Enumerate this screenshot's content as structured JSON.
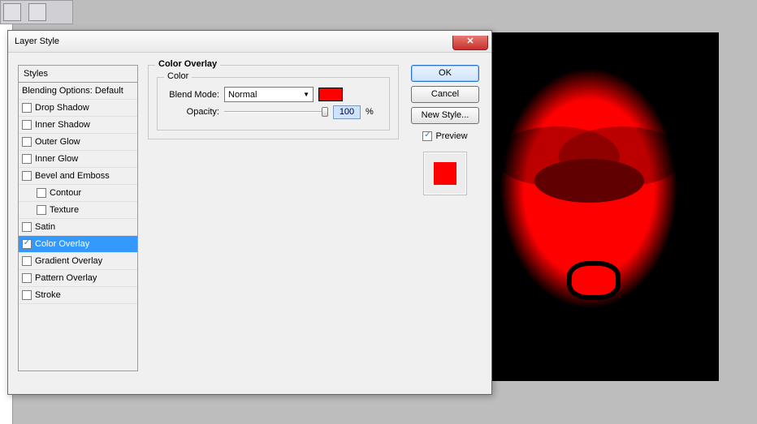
{
  "dialog": {
    "title": "Layer Style",
    "styles_header": "Styles",
    "styles": [
      {
        "label": "Blending Options: Default",
        "checked": null
      },
      {
        "label": "Drop Shadow",
        "checked": false
      },
      {
        "label": "Inner Shadow",
        "checked": false
      },
      {
        "label": "Outer Glow",
        "checked": false
      },
      {
        "label": "Inner Glow",
        "checked": false
      },
      {
        "label": "Bevel and Emboss",
        "checked": false
      },
      {
        "label": "Contour",
        "checked": false,
        "indent": true
      },
      {
        "label": "Texture",
        "checked": false,
        "indent": true
      },
      {
        "label": "Satin",
        "checked": false
      },
      {
        "label": "Color Overlay",
        "checked": true,
        "selected": true
      },
      {
        "label": "Gradient Overlay",
        "checked": false
      },
      {
        "label": "Pattern Overlay",
        "checked": false
      },
      {
        "label": "Stroke",
        "checked": false
      }
    ],
    "section_title": "Color Overlay",
    "color_group": "Color",
    "blend_mode_label": "Blend Mode:",
    "blend_mode_value": "Normal",
    "overlay_color": "#ff0000",
    "opacity_label": "Opacity:",
    "opacity_value": "100",
    "opacity_unit": "%",
    "buttons": {
      "ok": "OK",
      "cancel": "Cancel",
      "new_style": "New Style..."
    },
    "preview_label": "Preview",
    "preview_checked": true,
    "preview_color": "#ff0000"
  }
}
